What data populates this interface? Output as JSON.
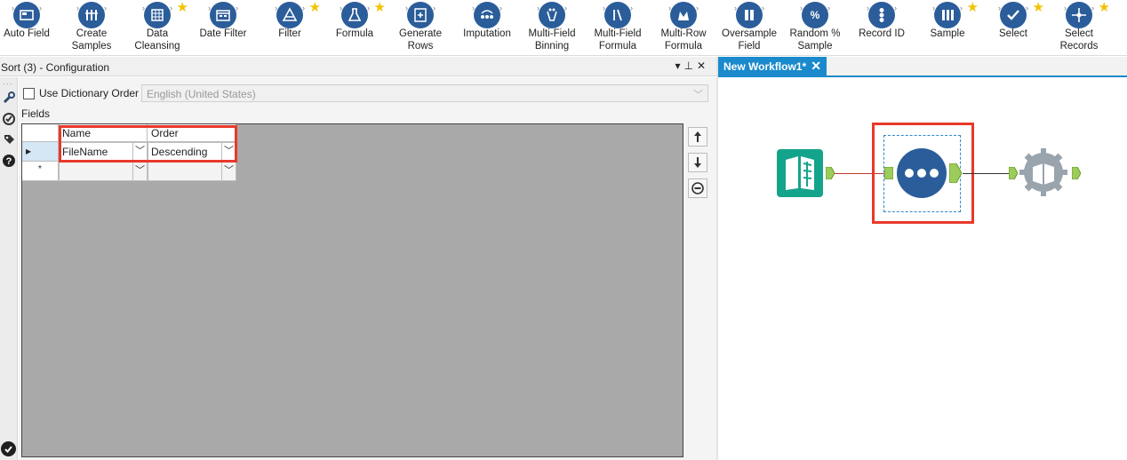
{
  "toolbar": {
    "tools": [
      {
        "label": "Auto Field",
        "icon": "auto-field-icon",
        "starred": false
      },
      {
        "label": "Create Samples",
        "icon": "create-samples-icon",
        "starred": false
      },
      {
        "label": "Data Cleansing",
        "icon": "data-cleansing-icon",
        "starred": true
      },
      {
        "label": "Date Filter",
        "icon": "date-filter-icon",
        "starred": false
      },
      {
        "label": "Filter",
        "icon": "filter-icon",
        "starred": true
      },
      {
        "label": "Formula",
        "icon": "formula-icon",
        "starred": true
      },
      {
        "label": "Generate Rows",
        "icon": "generate-rows-icon",
        "starred": false
      },
      {
        "label": "Imputation",
        "icon": "imputation-icon",
        "starred": false
      },
      {
        "label": "Multi-Field Binning",
        "icon": "multi-field-binning-icon",
        "starred": false
      },
      {
        "label": "Multi-Field Formula",
        "icon": "multi-field-formula-icon",
        "starred": false
      },
      {
        "label": "Multi-Row Formula",
        "icon": "multi-row-formula-icon",
        "starred": false
      },
      {
        "label": "Oversample Field",
        "icon": "oversample-field-icon",
        "starred": false
      },
      {
        "label": "Random % Sample",
        "icon": "random-sample-icon",
        "starred": false
      },
      {
        "label": "Record ID",
        "icon": "record-id-icon",
        "starred": false
      },
      {
        "label": "Sample",
        "icon": "sample-icon",
        "starred": true
      },
      {
        "label": "Select",
        "icon": "select-icon",
        "starred": true
      },
      {
        "label": "Select Records",
        "icon": "select-records-icon",
        "starred": true
      }
    ],
    "tool_color": "#2b5d9a",
    "star_color": "#f2c200"
  },
  "config": {
    "title": "Sort (3) - Configuration",
    "use_dictionary_label": "Use Dictionary Order",
    "use_dictionary_checked": false,
    "language_value": "English (United States)",
    "fields_label": "Fields",
    "columns": [
      "Name",
      "Order"
    ],
    "rows": [
      {
        "indicator": "▸",
        "name": "FileName",
        "order": "Descending"
      },
      {
        "indicator": "*",
        "name": "",
        "order": ""
      }
    ],
    "highlight_color": "#e8392a"
  },
  "workflow": {
    "tab_label": "New Workflow1*",
    "tab_color": "#1a8acc",
    "tools": [
      {
        "name": "input-data-tool",
        "icon": "book-icon",
        "color": "#14a38b"
      },
      {
        "name": "sort-tool",
        "icon": "sort-dots-icon",
        "color": "#2b5d9a"
      },
      {
        "name": "browse-tool",
        "icon": "browse-gear-icon",
        "color": "#9aa4ad"
      }
    ]
  }
}
